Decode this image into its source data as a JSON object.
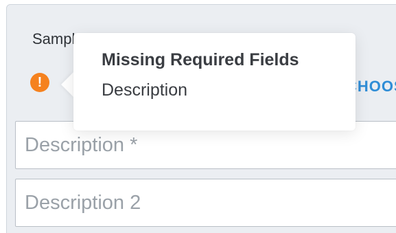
{
  "form": {
    "sample_type_label": "Sample Type:",
    "choose_link": "CHOOSE",
    "warning_icon_glyph": "!",
    "description_placeholder": "Description *",
    "description2_placeholder": "Description 2"
  },
  "tooltip": {
    "title": "Missing Required Fields",
    "body": "Description"
  },
  "colors": {
    "warning": "#f5821f",
    "link": "#2f8dd6",
    "panel_bg": "#ebeef2"
  },
  "icons": [
    "warning-icon"
  ]
}
